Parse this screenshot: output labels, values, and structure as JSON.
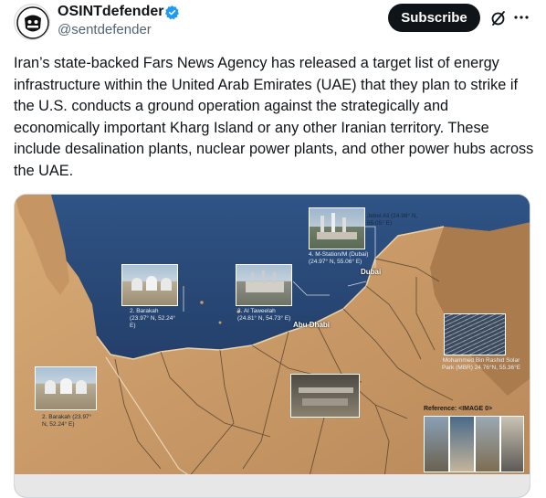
{
  "author": {
    "display_name": "OSINTdefender",
    "handle": "@sentdefender",
    "verified_color": "#1d9bf0"
  },
  "actions": {
    "subscribe_label": "Subscribe",
    "grok_icon": "grok-icon",
    "more_icon": "more-icon"
  },
  "post": {
    "text": "Iran’s state-backed Fars News Agency has released a target list of energy infrastructure within the United Arab Emirates (UAE) that they plan to strike if the U.S. conducts a ground operation against the strategically and economically important Kharg Island or any other Iranian territory. These include desalination plants, nuclear power plants, and other power hubs across the UAE."
  },
  "map": {
    "labels": {
      "jebel_ali": "Jebel Ali (24.98° N, 55.05° E)",
      "m_station": "4. M-Station/M (Dubai) (24.97° N, 55.06° E)",
      "dubai": "Dubai",
      "abu_dhabi": "Abu Dhabi",
      "barakah_1": "2. Barakah (23.97° N, 52.24° E)",
      "al_taweelah": "3. Al Taweelah (24.81° N, 54.73° E)",
      "mbr_solar": "Mohammed Bin Rashid Solar Park (MBR) 24.76°N, 55.36°E",
      "barakah_2": "2. Barakah (23.97° N, 52.24° E)",
      "reference": "Reference: <IMAGE 0>"
    },
    "colors": {
      "sea": "#2b4a78",
      "land": "#c99a66",
      "road": "#4a3a2a"
    }
  }
}
